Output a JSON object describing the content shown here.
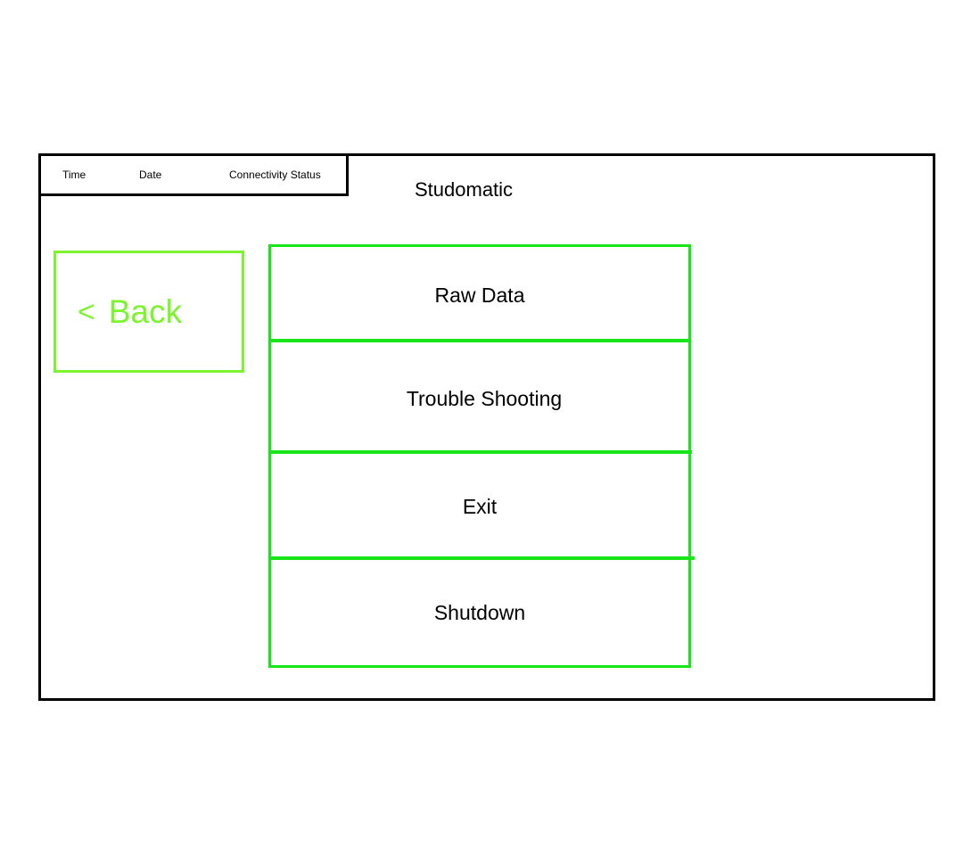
{
  "status_bar": {
    "time_label": "Time",
    "date_label": "Date",
    "connectivity_label": "Connectivity Status"
  },
  "app": {
    "title": "Studomatic"
  },
  "back_button": {
    "chevron": "<",
    "label": "Back"
  },
  "menu": {
    "items": [
      {
        "label": "Raw Data"
      },
      {
        "label": "Trouble Shooting"
      },
      {
        "label": "Exit"
      },
      {
        "label": "Shutdown"
      }
    ]
  },
  "colors": {
    "frame": "#000000",
    "back_accent": "#7cf52e",
    "menu_border": "#19e619",
    "text": "#000000",
    "background": "#ffffff"
  }
}
